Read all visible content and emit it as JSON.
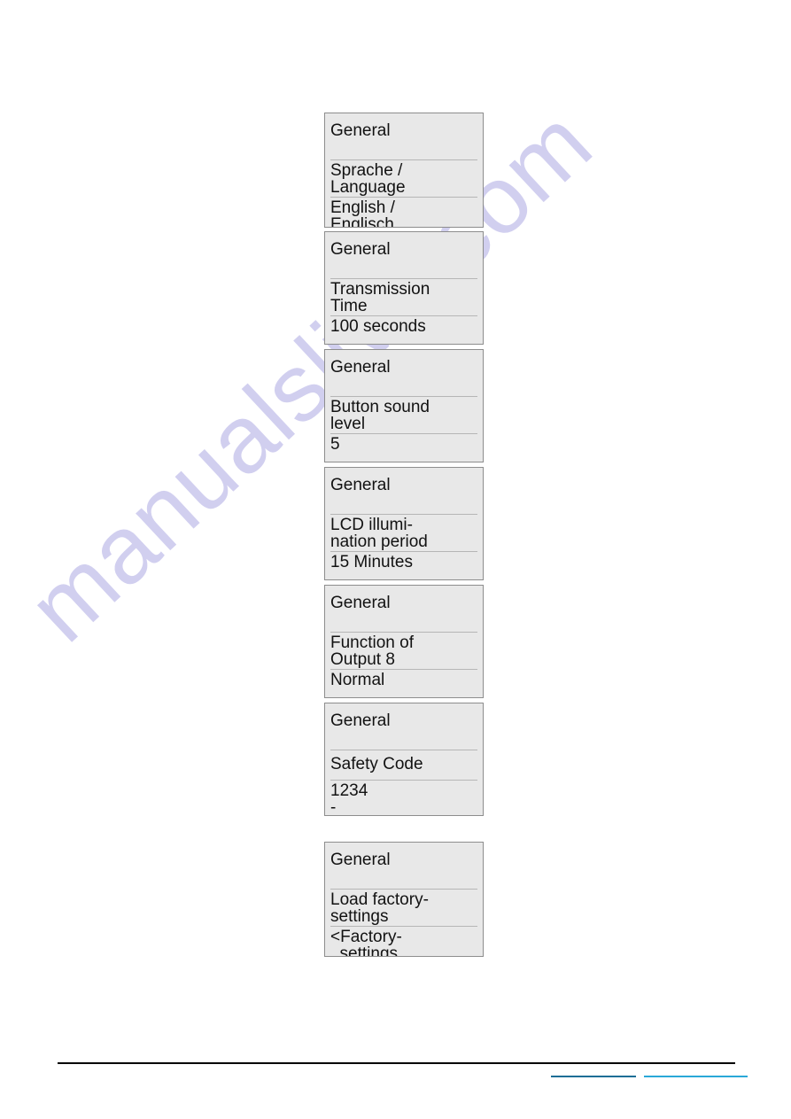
{
  "page": {
    "background_color": "#ffffff",
    "watermark_text": "manualslive.com",
    "watermark_color": "#cfcdef"
  },
  "screens": [
    {
      "title": "General",
      "label_lines": [
        "Sprache /",
        "Language"
      ],
      "value_lines": [
        "English /",
        "Englisch"
      ],
      "label_gap": false
    },
    {
      "title": "General",
      "label_lines": [
        "Transmission",
        "Time"
      ],
      "value_lines": [
        "100 seconds"
      ],
      "label_gap": true
    },
    {
      "title": "General",
      "label_lines": [
        "Button sound",
        "level"
      ],
      "value_lines": [
        "5"
      ],
      "label_gap": false
    },
    {
      "title": "General",
      "label_lines": [
        "LCD illumi-",
        "nation period"
      ],
      "value_lines": [
        "15 Minutes"
      ],
      "label_gap": true
    },
    {
      "title": "General",
      "label_lines": [
        "Function of",
        "Output 8"
      ],
      "value_lines": [
        "Normal"
      ],
      "label_gap": true
    },
    {
      "title": "General",
      "label_lines": [
        "Safety Code"
      ],
      "value_lines": [
        "1234",
        "-"
      ],
      "label_gap": false
    },
    {
      "title": "General",
      "label_lines": [
        "Load factory-",
        "settings"
      ],
      "value_lines": [
        "<Factory-",
        "  settings"
      ],
      "label_gap": true
    }
  ],
  "footer": {
    "divider_color": "#000000",
    "link_left_color": "#1b6e96",
    "link_right_color": "#2aa8d8",
    "link_left_text": "",
    "link_right_text": ""
  }
}
